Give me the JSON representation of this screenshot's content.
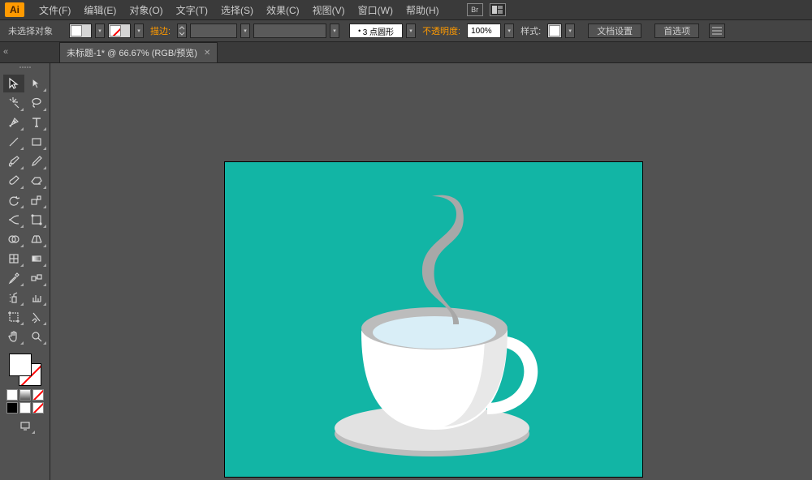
{
  "app": {
    "logo": "Ai"
  },
  "menu": {
    "file": "文件(F)",
    "edit": "编辑(E)",
    "object": "对象(O)",
    "type": "文字(T)",
    "select": "选择(S)",
    "effect": "效果(C)",
    "view": "视图(V)",
    "window": "窗口(W)",
    "help": "帮助(H)"
  },
  "optbar": {
    "selection": "未选择对象",
    "stroke_label": "描边:",
    "stroke_info": "3 点圆形",
    "opacity_label": "不透明度:",
    "opacity_value": "100%",
    "style_label": "样式:",
    "btn_docsetup": "文档设置",
    "btn_prefs": "首选项"
  },
  "tab": {
    "title": "未标题-1* @ 66.67% (RGB/预览)"
  },
  "tool_names": [
    "selection-tool",
    "direct-selection-tool",
    "magic-wand-tool",
    "lasso-tool",
    "pen-tool",
    "type-tool",
    "line-tool",
    "rectangle-tool",
    "paintbrush-tool",
    "pencil-tool",
    "blob-brush-tool",
    "eraser-tool",
    "rotate-tool",
    "scale-tool",
    "width-tool",
    "free-transform-tool",
    "shape-builder-tool",
    "perspective-tool",
    "mesh-tool",
    "gradient-tool",
    "eyedropper-tool",
    "blend-tool",
    "symbol-sprayer-tool",
    "graph-tool",
    "artboard-tool",
    "slice-tool",
    "hand-tool",
    "zoom-tool"
  ],
  "icons": {
    "bridge": "Br"
  }
}
